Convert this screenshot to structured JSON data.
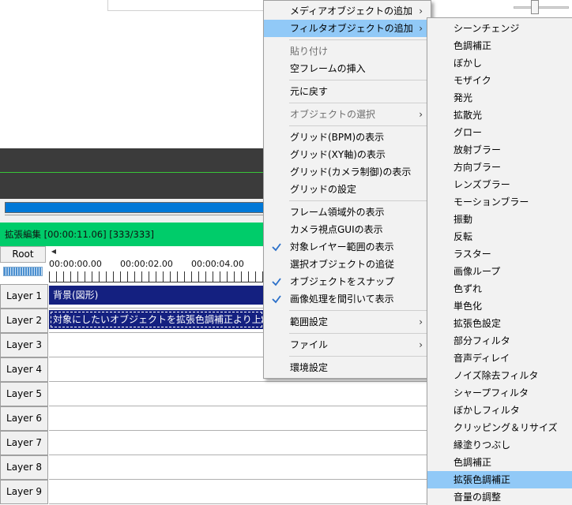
{
  "timeline": {
    "header_text": "拡張編集 [00:00:11.06] [333/333]",
    "root_label": "Root",
    "time_labels": [
      "00:00:00.00",
      "00:00:02.00",
      "00:00:04.00"
    ],
    "layers": [
      {
        "label": "Layer 1",
        "clip": "背景(図形)"
      },
      {
        "label": "Layer 2",
        "clip": "対象にしたいオブジェクトを拡張色調補正より上に配置"
      },
      {
        "label": "Layer 3",
        "clip": null
      },
      {
        "label": "Layer 4",
        "clip": null
      },
      {
        "label": "Layer 5",
        "clip": null
      },
      {
        "label": "Layer 6",
        "clip": null
      },
      {
        "label": "Layer 7",
        "clip": null
      },
      {
        "label": "Layer 8",
        "clip": null
      },
      {
        "label": "Layer 9",
        "clip": null
      }
    ]
  },
  "context_menu": {
    "items": [
      {
        "label": "メディアオブジェクトの追加",
        "submenu": true
      },
      {
        "label": "フィルタオブジェクトの追加",
        "submenu": true,
        "highlighted": true
      },
      {
        "separator": true
      },
      {
        "label": "貼り付け",
        "disabled": true
      },
      {
        "label": "空フレームの挿入"
      },
      {
        "separator": true
      },
      {
        "label": "元に戻す"
      },
      {
        "separator": true
      },
      {
        "label": "オブジェクトの選択",
        "submenu": true,
        "disabled": true
      },
      {
        "separator": true
      },
      {
        "label": "グリッド(BPM)の表示"
      },
      {
        "label": "グリッド(XY軸)の表示"
      },
      {
        "label": "グリッド(カメラ制御)の表示"
      },
      {
        "label": "グリッドの設定"
      },
      {
        "separator": true
      },
      {
        "label": "フレーム領域外の表示"
      },
      {
        "label": "カメラ視点GUIの表示"
      },
      {
        "label": "対象レイヤー範囲の表示",
        "checked": true
      },
      {
        "label": "選択オブジェクトの追従"
      },
      {
        "label": "オブジェクトをスナップ",
        "checked": true
      },
      {
        "label": "画像処理を間引いて表示",
        "checked": true
      },
      {
        "separator": true
      },
      {
        "label": "範囲設定",
        "submenu": true
      },
      {
        "separator": true
      },
      {
        "label": "ファイル",
        "submenu": true
      },
      {
        "separator": true
      },
      {
        "label": "環境設定"
      }
    ]
  },
  "filter_submenu": {
    "items": [
      {
        "label": "シーンチェンジ"
      },
      {
        "label": "色調補正"
      },
      {
        "label": "ぼかし"
      },
      {
        "label": "モザイク"
      },
      {
        "label": "発光"
      },
      {
        "label": "拡散光"
      },
      {
        "label": "グロー"
      },
      {
        "label": "放射ブラー"
      },
      {
        "label": "方向ブラー"
      },
      {
        "label": "レンズブラー"
      },
      {
        "label": "モーションブラー"
      },
      {
        "label": "振動"
      },
      {
        "label": "反転"
      },
      {
        "label": "ラスター"
      },
      {
        "label": "画像ループ"
      },
      {
        "label": "色ずれ"
      },
      {
        "label": "単色化"
      },
      {
        "label": "拡張色設定"
      },
      {
        "label": "部分フィルタ"
      },
      {
        "label": "音声ディレイ"
      },
      {
        "label": "ノイズ除去フィルタ"
      },
      {
        "label": "シャープフィルタ"
      },
      {
        "label": "ぼかしフィルタ"
      },
      {
        "label": "クリッピング＆リサイズ"
      },
      {
        "label": "縁塗りつぶし"
      },
      {
        "label": "色調補正"
      },
      {
        "label": "拡張色調補正",
        "highlighted": true
      },
      {
        "label": "音量の調整"
      }
    ]
  },
  "colors": {
    "timeline_header": "#00cc6a",
    "clip": "#142080",
    "menu_highlight": "#91c9f7",
    "seek_bar": "#0078d7"
  },
  "icons": {
    "submenu": "chevron-right-icon",
    "checked": "checkmark-icon"
  }
}
